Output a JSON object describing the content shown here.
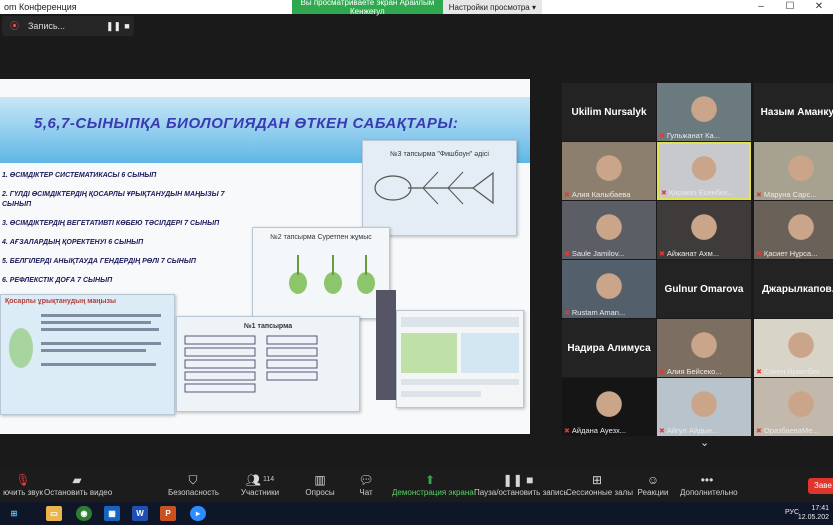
{
  "window": {
    "app_title": "om Конференция",
    "share_message": "Вы просматриваете экран Арайлым Кенжеғул",
    "view_options": "Настройки просмотра"
  },
  "recording": {
    "label": "Запись..."
  },
  "slide": {
    "title": "5,6,7-СЫНЫПҚА БИОЛОГИЯДАН ӨТКЕН САБАҚТАРЫ:",
    "topics": [
      "1. ӨСІМДІКТЕР СИСТЕМАТИКАСЫ 6 СЫНЫП",
      "2. ГҮЛДІ ӨСІМДІКТЕРДІҢ ҚОСАРЛЫ ҰРЫҚТАНУДЫН МАҢЫЗЫ 7 СЫНЫП",
      "3. ӨСІМДІКТЕРДІҢ ВЕГЕТАТИВТІ КӨБЕЮ ТӘСІЛДЕРІ 7 СЫНЫП",
      "4. АҒЗАЛАРДЫҢ ҚОРЕКТЕНУІ 6 СЫНЫП",
      "5. БЕЛГІЛЕРДІ АНЫҚТАУДА ГЕНДЕРДІҢ РӨЛІ 7 СЫНЫП",
      "6. РЕФЛЕКСТІК ДОҒА 7 СЫНЫП"
    ],
    "card_fish_title": "№3 тапсырма \"Фишбоун\" әдісі",
    "card_plants_title": "№2 тапсырма Суретпен жұмыс",
    "card_table_title": "№1 тапсырма",
    "card_left_title": "Қосарлы ұрықтанудың маңызы"
  },
  "gallery": [
    {
      "name": "Ukilim Nursalyk",
      "type": "name",
      "muted": false
    },
    {
      "name": "Гульжанат Ка...",
      "type": "video",
      "muted": true,
      "bg": "#6b7a7e"
    },
    {
      "name": "Назым Аманку...",
      "type": "name",
      "muted": false
    },
    {
      "name": "Алия Калыбаева",
      "type": "video",
      "muted": true,
      "bg": "#8c7f6d"
    },
    {
      "name": "Қаракөз Есенбек...",
      "type": "video",
      "muted": true,
      "bg": "#c7c9cc",
      "active": true
    },
    {
      "name": "Маруна Сарс...",
      "type": "video",
      "muted": true,
      "bg": "#a6a28f"
    },
    {
      "name": "Saule Jamilov...",
      "type": "video",
      "muted": true,
      "bg": "#5b5e64"
    },
    {
      "name": "Айжанат Ахм...",
      "type": "video",
      "muted": true,
      "bg": "#3f3b3b"
    },
    {
      "name": "Қасиет Нұрса...",
      "type": "video",
      "muted": true,
      "bg": "#6a6259"
    },
    {
      "name": "Rustam Aman...",
      "type": "video",
      "muted": true,
      "bg": "#53606b"
    },
    {
      "name": "Gulnur Omarova",
      "type": "name",
      "muted": false
    },
    {
      "name": "Джарылкапов...",
      "type": "name",
      "muted": false
    },
    {
      "name": "Надира Алимуса",
      "type": "name",
      "muted": false
    },
    {
      "name": "Алия Бейсеко...",
      "type": "video",
      "muted": true,
      "bg": "#7c6f62"
    },
    {
      "name": "Сакен Иркитбек",
      "type": "video",
      "muted": true,
      "bg": "#d9d4c8"
    },
    {
      "name": "Айдана Ауезх...",
      "type": "video",
      "muted": true,
      "bg": "#151515"
    },
    {
      "name": "Айгул Айдын...",
      "type": "video",
      "muted": true,
      "bg": "#b9c3cc"
    },
    {
      "name": "ОразбаеваМе...",
      "type": "video",
      "muted": true,
      "bg": "#c2b8ab"
    }
  ],
  "toolbar": {
    "mute": "ючить звук",
    "video": "Остановить видео",
    "security": "Безопасность",
    "participants": "Участники",
    "participants_count": "114",
    "polls": "Опросы",
    "chat": "Чат",
    "share": "Демонстрация экрана",
    "pause_recording": "Пауза/остановить запись",
    "breakout": "Сессионные залы",
    "reactions": "Реакции",
    "more": "Дополнительно",
    "end": "Заве"
  },
  "taskbar": {
    "lang": "РУС",
    "time": "17:41",
    "date": "12.05.202"
  },
  "colors": {
    "share_green": "#2fa84f",
    "end_red": "#e0352b",
    "mic_red": "#e53935",
    "active_speaker": "#e2e24a"
  }
}
